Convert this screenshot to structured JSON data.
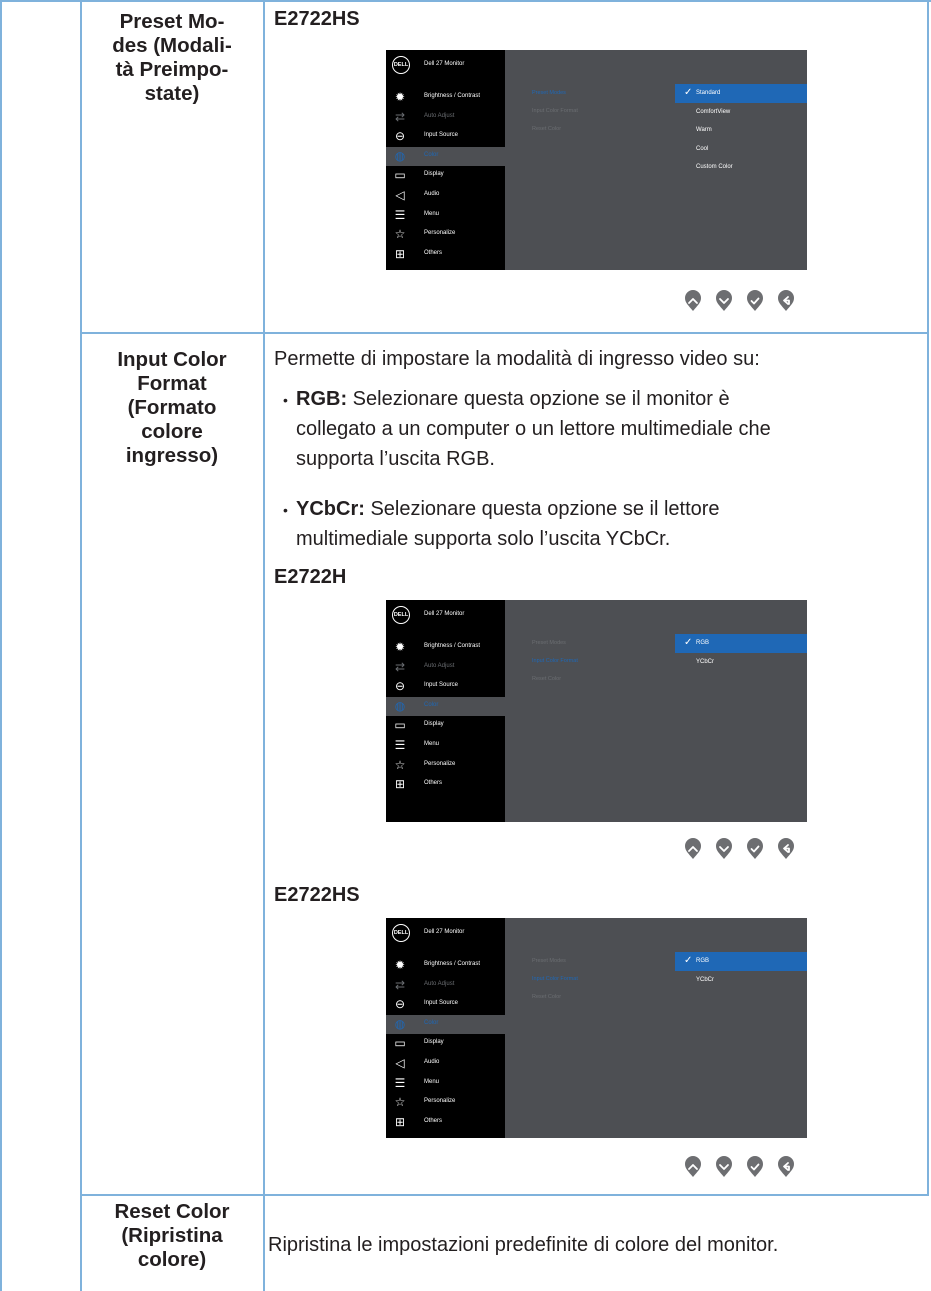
{
  "rows": [
    {
      "label": "Preset Mo-\ndes (Modali-\ntà Preimpo-\nstate)",
      "model": "E2722HS"
    },
    {
      "label": "Input Color\nFormat\n(Formato\ncolore\ningresso)",
      "intro": "Permette di impostare la modalità di ingresso video su:",
      "bullets": [
        {
          "term": "RGB:",
          "line1": " Selezionare questa opzione se il monitor è",
          "line2": "collegato a un computer o un lettore multimediale che",
          "line3": "supporta l’uscita RGB."
        },
        {
          "term": "YCbCr:",
          "line1": " Selezionare questa opzione se il lettore",
          "line2": "multimediale supporta solo l’uscita YCbCr."
        }
      ],
      "model_a": "E2722H",
      "model_b": "E2722HS"
    },
    {
      "label": "Reset Color\n(Ripristina\ncolore)",
      "text": "Ripristina le impostazioni predefinite di colore del monitor."
    }
  ],
  "osd": {
    "logo": "DELL",
    "title": "Dell 27 Monitor",
    "menu_full": [
      "Brightness / Contrast",
      "Auto Adjust",
      "Input Source",
      "Color",
      "Display",
      "Audio",
      "Menu",
      "Personalize",
      "Others"
    ],
    "menu_noaudio": [
      "Brightness / Contrast",
      "Auto Adjust",
      "Input Source",
      "Color",
      "Display",
      "Menu",
      "Personalize",
      "Others"
    ],
    "submenu": [
      "Preset Modes",
      "Input Color Format",
      "Reset Color"
    ],
    "preset_options": [
      "Standard",
      "ComfortView",
      "Warm",
      "Cool",
      "Custom Color"
    ],
    "format_options": [
      "RGB",
      "YCbCr"
    ]
  },
  "colors": {
    "border": "#7fb2dc",
    "osd_bg": "#4d4f53",
    "osd_sidebar": "#000000",
    "highlight": "#1f68b6"
  },
  "icons": [
    "brightness-icon",
    "auto-adjust-icon",
    "input-source-icon",
    "color-icon",
    "display-icon",
    "audio-icon",
    "menu-icon",
    "personalize-icon",
    "others-icon",
    "up-arrow-icon",
    "down-arrow-icon",
    "check-icon",
    "back-icon"
  ]
}
